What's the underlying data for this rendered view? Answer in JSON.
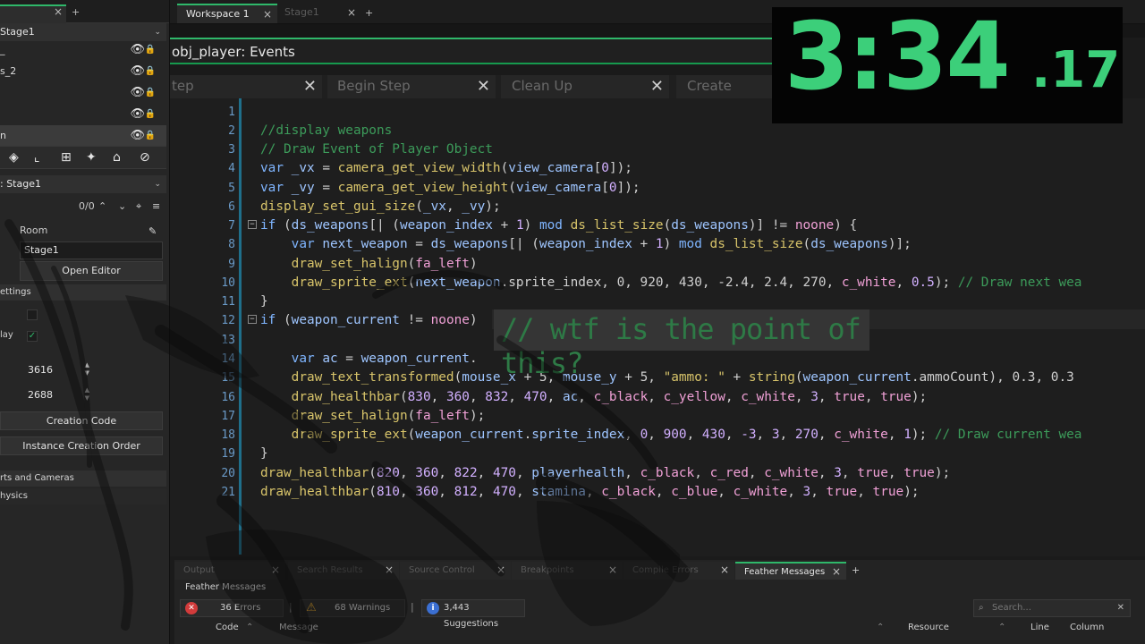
{
  "left_panel": {
    "layers_dropdown": "Stage1",
    "layers": [
      {
        "name": "_"
      },
      {
        "name": "s_2"
      },
      {
        "name": ""
      },
      {
        "name": ""
      },
      {
        "name": "n"
      }
    ],
    "instances_dropdown": ": Stage1",
    "counter": "0/0",
    "room_label": "Room",
    "room_value": "Stage1",
    "open_editor": "Open Editor",
    "settings_section": "ettings",
    "display_label": "lay",
    "width_value": "3616",
    "height_value": "2688",
    "creation_code": "Creation Code",
    "instance_creation_order": "Instance Creation Order",
    "viewports_section": "rts and Cameras",
    "physics_section": "hysics"
  },
  "workspace_tabs": [
    {
      "label": "Workspace 1",
      "close": "×"
    },
    {
      "label": "Stage1",
      "close": "×"
    }
  ],
  "add_tab": "+",
  "editor": {
    "title": "obj_player: Events",
    "event_tabs": [
      {
        "label": "tep",
        "close": "✕"
      },
      {
        "label": "Begin Step",
        "close": "✕"
      },
      {
        "label": "Clean Up",
        "close": "✕"
      },
      {
        "label": "Create",
        "close": ""
      }
    ],
    "line_numbers": [
      "1",
      "2",
      "3",
      "4",
      "5",
      "6",
      "7",
      "8",
      "9",
      "10",
      "11",
      "12",
      "13",
      "14",
      "15",
      "16",
      "17",
      "18",
      "19",
      "20",
      "21"
    ],
    "note": "// wtf is the point of this?"
  },
  "timer": {
    "main": "3:34",
    "fraction": ".17"
  },
  "output_panel": {
    "tabs": [
      {
        "label": "Output",
        "close": "×"
      },
      {
        "label": "Search Results",
        "close": "×"
      },
      {
        "label": "Source Control",
        "close": "×"
      },
      {
        "label": "Breakpoints",
        "close": "×"
      },
      {
        "label": "Compile Errors",
        "close": "×"
      },
      {
        "label": "Feather Messages",
        "close": "×"
      }
    ],
    "add_tab": "+",
    "heading": "Feather Messages",
    "errors": "36 Errors",
    "warnings": "68 Warnings",
    "suggestions": "3,443 Suggestions",
    "search_placeholder": "Search...",
    "columns": {
      "code": "Code",
      "message": "Message",
      "resource": "Resource",
      "line": "Line",
      "column": "Column"
    }
  },
  "colors": {
    "accent": "#2fb86a",
    "timer": "#3ccf7a",
    "comment": "#3c9b5a"
  }
}
